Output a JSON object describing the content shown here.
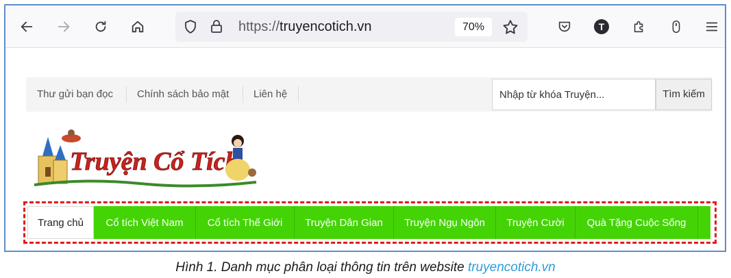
{
  "browser": {
    "url_scheme": "https://",
    "url_host": "truyencotich.vn",
    "zoom": "70%",
    "profile_initial": "T",
    "icons": [
      "back-arrow-icon",
      "forward-arrow-icon",
      "reload-icon",
      "home-icon",
      "shield-icon",
      "lock-icon",
      "star-icon",
      "pocket-icon",
      "account-icon",
      "extensions-icon",
      "mouse-icon",
      "hamburger-menu-icon"
    ]
  },
  "topbar": {
    "links": [
      "Thư gửi bạn đọc",
      "Chính sách bảo mật",
      "Liên hệ"
    ],
    "search_placeholder": "Nhập từ khóa Truyện...",
    "search_button": "Tìm kiếm"
  },
  "logo": {
    "text": "Truyện Cổ Tích"
  },
  "menu": {
    "items": [
      "Trang chủ",
      "Cổ tích Việt Nam",
      "Cổ tích Thế Giới",
      "Truyện Dân Gian",
      "Truyện Ngụ Ngôn",
      "Truyện Cười",
      "Quà Tặng Cuộc Sống"
    ],
    "active_index": 0
  },
  "caption": {
    "text": "Hình 1. Danh mục phân loại thông tin trên website ",
    "site": "truyencotich.vn"
  },
  "colors": {
    "menu_green": "#44d406",
    "outline_red": "#e01b1b",
    "caption_link": "#2e9cdb",
    "frame_border": "#5b8fc7"
  }
}
